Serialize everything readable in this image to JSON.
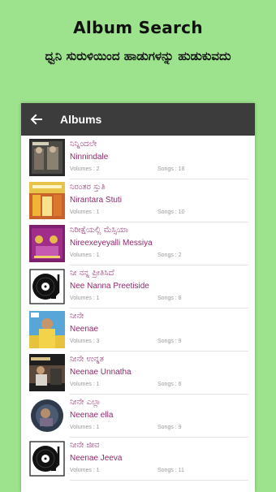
{
  "promo": {
    "title": "Album Search",
    "subtitle": "ಧ್ವನಿ ಸುರುಳಿಯಿಂದ ಹಾಡುಗಳನ್ನು ಹುಡುಕುವದು"
  },
  "appbar": {
    "title": "Albums",
    "back_icon": "arrow-left-icon"
  },
  "labels": {
    "volumes": "Volumes",
    "songs": "Songs"
  },
  "albums": [
    {
      "kn": "ನಿನ್ನಿಂದಲೇ",
      "en": "Ninnindale",
      "volumes": "Volumes : 2",
      "songs": "Songs : 18",
      "thumb": "photo"
    },
    {
      "kn": "ನಿರಂತರ ಸ್ತುತಿ",
      "en": "Nirantara Stuti",
      "volumes": "Volumes : 1",
      "songs": "Songs : 10",
      "thumb": "photo"
    },
    {
      "kn": "ನಿರೀಕ್ಷೆಯಲ್ಲಿ ಮೆಸ್ಸಿಯಾ",
      "en": "Nireexeyeyalli Messiya",
      "volumes": "Volumes : 1",
      "songs": "Songs : 2",
      "thumb": "photo"
    },
    {
      "kn": "ನೀ ನನ್ನ ಪ್ರೀತಿಸಿದೆ",
      "en": "Nee Nanna Preetiside",
      "volumes": "Volumes : 1",
      "songs": "Songs : 8",
      "thumb": "record"
    },
    {
      "kn": "ನೀನೇ",
      "en": "Neenae",
      "volumes": "Volumes : 3",
      "songs": "Songs : 9",
      "thumb": "photo"
    },
    {
      "kn": "ನೀನೇ ಉನ್ನತ",
      "en": "Neenae Unnatha",
      "volumes": "Volumes : 1",
      "songs": "Songs : 6",
      "thumb": "photo"
    },
    {
      "kn": "ನೀನೇ ಎಲ್ಲಾ",
      "en": "Neenae ella",
      "volumes": "Volumes : 1",
      "songs": "Songs : 9",
      "thumb": "photo"
    },
    {
      "kn": "ನೀನೇ ಜೀವ",
      "en": "Neenae Jeeva",
      "volumes": "Volumes : 1",
      "songs": "Songs : 11",
      "thumb": "record"
    }
  ],
  "colors": {
    "background": "#9de38d",
    "appbar": "#3c3c3c",
    "title_text": "#8e2a6c",
    "meta_text": "#9a9a9a"
  }
}
